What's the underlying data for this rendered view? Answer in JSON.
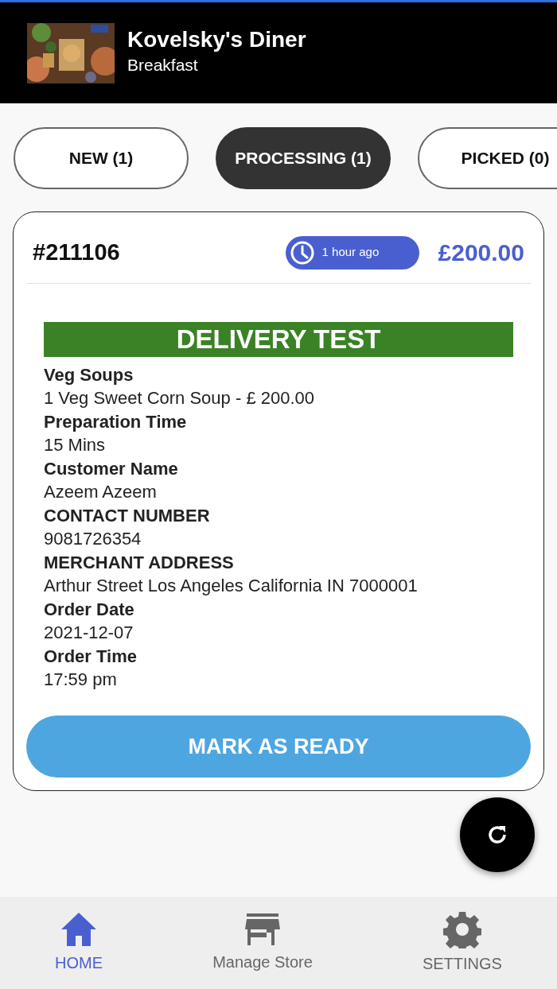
{
  "header": {
    "title": "Kovelsky's Diner",
    "subtitle": "Breakfast"
  },
  "tabs": [
    {
      "label": "NEW (1)",
      "selected": false
    },
    {
      "label": "PROCESSING (1)",
      "selected": true
    },
    {
      "label": "PICKED (0)",
      "selected": false
    }
  ],
  "order": {
    "number": "#211106",
    "time_badge": "1 hour ago",
    "total": "£200.00",
    "banner": "DELIVERY TEST",
    "details": [
      {
        "label": "Veg Soups",
        "value": "1 Veg Sweet Corn Soup - £ 200.00"
      },
      {
        "label": "Preparation Time",
        "value": "15 Mins"
      },
      {
        "label": "Customer Name",
        "value": "Azeem Azeem"
      },
      {
        "label": "CONTACT NUMBER",
        "value": "9081726354"
      },
      {
        "label": "MERCHANT ADDRESS",
        "value": "Arthur Street Los Angeles California IN 7000001"
      },
      {
        "label": "Order Date",
        "value": "2021-12-07"
      },
      {
        "label": "Order Time",
        "value": "17:59 pm"
      }
    ],
    "action": "MARK AS READY"
  },
  "bottom_nav": [
    {
      "kind": "home",
      "label": "HOME",
      "selected": true
    },
    {
      "kind": "store",
      "label": "Manage Store",
      "selected": false
    },
    {
      "kind": "settings",
      "label": "SETTINGS",
      "selected": false
    }
  ]
}
